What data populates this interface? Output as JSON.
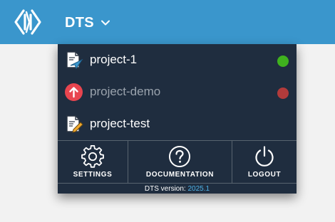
{
  "app": {
    "name": "DTS"
  },
  "projects": [
    {
      "name": "project-1",
      "icon": "document-send-icon",
      "status_color": "#3fb21e",
      "muted": false
    },
    {
      "name": "project-demo",
      "icon": "upload-arrow-icon",
      "status_color": "#b23b3b",
      "muted": true
    },
    {
      "name": "project-test",
      "icon": "document-edit-icon",
      "status_color": null,
      "muted": false
    }
  ],
  "actions": [
    {
      "label": "SETTINGS",
      "icon": "gear-icon"
    },
    {
      "label": "DOCUMENTATION",
      "icon": "question-circle-icon"
    },
    {
      "label": "LOGOUT",
      "icon": "power-icon"
    }
  ],
  "version": {
    "label": "DTS version:",
    "value": "2025.1"
  },
  "colors": {
    "topbar": "#3a96cc",
    "menu_bg": "#1f2d3f",
    "accent": "#4fb3e8"
  }
}
